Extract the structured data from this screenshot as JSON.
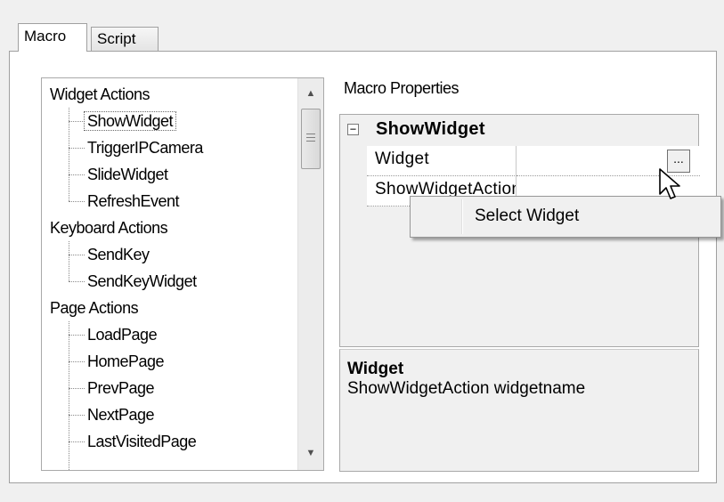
{
  "tabs": [
    {
      "label": "Macro",
      "active": true
    },
    {
      "label": "Script",
      "active": false
    }
  ],
  "tree": {
    "groups": [
      {
        "label": "Widget Actions",
        "items": [
          "ShowWidget",
          "TriggerIPCamera",
          "SlideWidget",
          "RefreshEvent"
        ]
      },
      {
        "label": "Keyboard Actions",
        "items": [
          "SendKey",
          "SendKeyWidget"
        ]
      },
      {
        "label": "Page Actions",
        "items": [
          "LoadPage",
          "HomePage",
          "PrevPage",
          "NextPage",
          "LastVisitedPage"
        ]
      }
    ],
    "selected": "ShowWidget"
  },
  "properties": {
    "title": "Macro Properties",
    "category": "ShowWidget",
    "rows": [
      {
        "name": "Widget",
        "value": ""
      },
      {
        "name": "ShowWidgetAction",
        "value": ""
      }
    ],
    "ellipsis_label": "..."
  },
  "description": {
    "title": "Widget",
    "text": "ShowWidgetAction widgetname"
  },
  "context_menu": {
    "items": [
      "Select Widget"
    ]
  },
  "colors": {
    "window_bg": "#f0f0f0",
    "panel_bg": "#ffffff",
    "border": "#a0a0a0"
  }
}
